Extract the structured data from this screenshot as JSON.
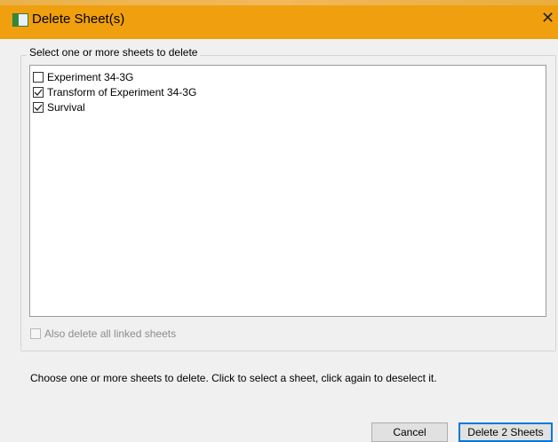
{
  "window": {
    "title": "Delete Sheet(s)",
    "close_glyph": "✕"
  },
  "group": {
    "label": "Select one or more sheets to delete"
  },
  "sheets": [
    {
      "label": "Experiment 34-3G",
      "checked": false
    },
    {
      "label": "Transform of Experiment 34-3G",
      "checked": true
    },
    {
      "label": "Survival",
      "checked": true
    }
  ],
  "linked_option": {
    "label": "Also delete all linked sheets",
    "checked": false,
    "enabled": false
  },
  "hint": "Choose one or more sheets to delete. Click to select a sheet, click again to deselect it.",
  "buttons": {
    "cancel": "Cancel",
    "delete": "Delete 2 Sheets"
  },
  "colors": {
    "titlebar": "#f0a00e",
    "default_button_border": "#0078d7"
  }
}
